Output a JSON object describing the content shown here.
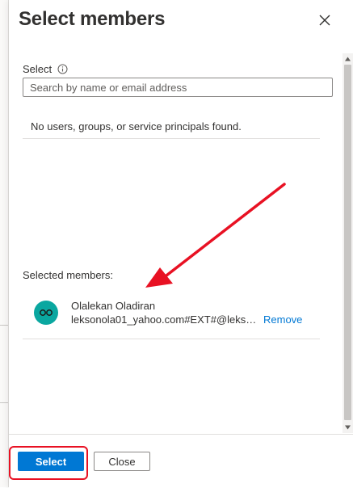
{
  "panel": {
    "title": "Select members",
    "close_icon": "close-icon"
  },
  "select_field": {
    "label": "Select",
    "info_icon": "info-icon",
    "placeholder": "Search by name or email address",
    "value": ""
  },
  "results": {
    "empty_message": "No users, groups, or service principals found."
  },
  "selected": {
    "label": "Selected members:",
    "members": [
      {
        "name": "Olalekan Oladiran",
        "email": "leksonola01_yahoo.com#EXT#@lekso...",
        "avatar_icon": "infinity-icon",
        "avatar_color": "#0aa7a0",
        "remove_label": "Remove"
      }
    ]
  },
  "footer": {
    "select_label": "Select",
    "close_label": "Close"
  },
  "colors": {
    "primary": "#0078d4",
    "annotation": "#e81123",
    "link": "#0078d4"
  },
  "annotations": {
    "arrow": "red-arrow-icon",
    "highlight": "red-highlight-box"
  }
}
